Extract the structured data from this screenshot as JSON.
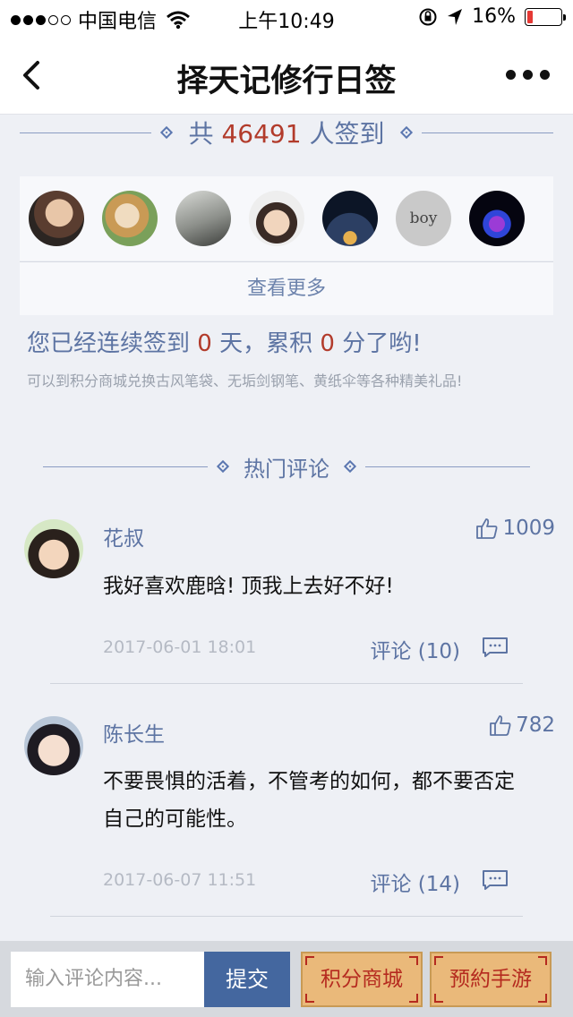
{
  "status_bar": {
    "carrier": "中国电信",
    "time": "上午10:49",
    "battery": "16%",
    "battery_level": 0.16
  },
  "nav": {
    "title": "择天记修行日签"
  },
  "checkin": {
    "prefix": "共",
    "count": "46491",
    "suffix": "人签到",
    "boy_avatar_text": "boy",
    "view_more": "查看更多"
  },
  "streak": {
    "part1": "您已经连续签到",
    "days": "0",
    "part2": "天，累积",
    "points": "0",
    "part3": "分了哟!",
    "hint": "可以到积分商城兑换古风笔袋、无垢剑钢笔、黄纸伞等各种精美礼品!"
  },
  "hot": {
    "title": "热门评论"
  },
  "comments": [
    {
      "name": "花叔",
      "likes": "1009",
      "text": "我好喜欢鹿晗! 顶我上去好不好!",
      "date": "2017-06-01 18:01",
      "reply": "评论 (10)"
    },
    {
      "name": "陈长生",
      "likes": "782",
      "text": "不要畏惧的活着，不管考的如何，都不要否定自己的可能性。",
      "date": "2017-06-07 11:51",
      "reply": "评论 (14)"
    }
  ],
  "bottom": {
    "input_placeholder": "输入评论内容...",
    "submit": "提交",
    "shop": "积分商城",
    "game": "预約手游"
  }
}
